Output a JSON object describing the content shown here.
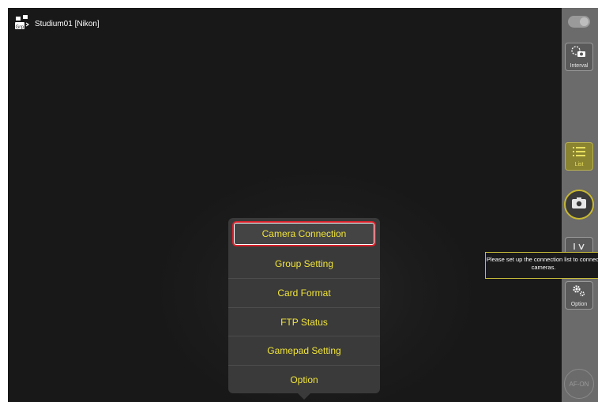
{
  "window": {
    "title": "Studium01 [Nikon]"
  },
  "rightbar": {
    "interval_label": "Interval",
    "list_label": "List",
    "option_label": "Option",
    "afon_label": "AF-ON"
  },
  "menu": {
    "items": [
      {
        "label": "Camera Connection"
      },
      {
        "label": "Group Setting"
      },
      {
        "label": "Card Format"
      },
      {
        "label": "FTP Status"
      },
      {
        "label": "Gamepad Setting"
      },
      {
        "label": "Option"
      }
    ]
  },
  "tooltip": {
    "text": "Please set up the connection list to connect cameras."
  },
  "colors": {
    "accent": "#f0e43a",
    "selected_border": "#d8202a",
    "background": "#181818"
  }
}
